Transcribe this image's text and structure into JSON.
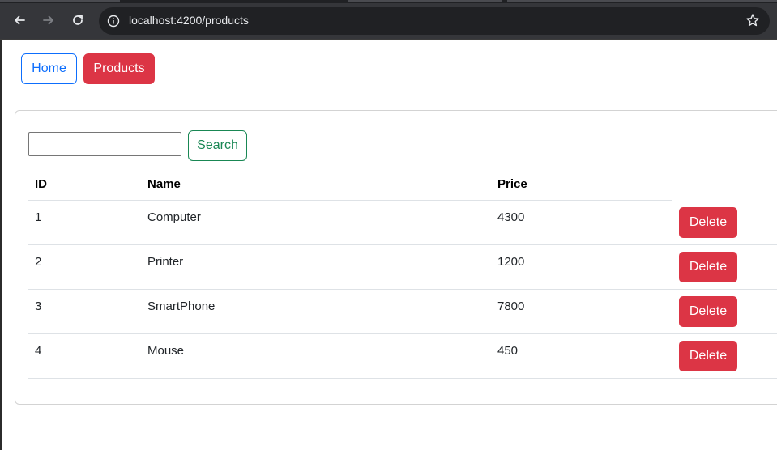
{
  "browser": {
    "url": "localhost:4200/products",
    "back_icon": "arrow-left-icon",
    "forward_icon": "arrow-right-icon",
    "reload_icon": "reload-icon",
    "site_info_icon": "info-icon",
    "bookmark_icon": "star-icon"
  },
  "nav": {
    "home_label": "Home",
    "products_label": "Products"
  },
  "search": {
    "value": "",
    "placeholder": "",
    "button_label": "Search"
  },
  "table": {
    "headers": [
      "ID",
      "Name",
      "Price"
    ],
    "rows": [
      {
        "id": "1",
        "name": "Computer",
        "price": "4300",
        "action": "Delete"
      },
      {
        "id": "2",
        "name": "Printer",
        "price": "1200",
        "action": "Delete"
      },
      {
        "id": "3",
        "name": "SmartPhone",
        "price": "7800",
        "action": "Delete"
      },
      {
        "id": "4",
        "name": "Mouse",
        "price": "450",
        "action": "Delete"
      }
    ]
  },
  "colors": {
    "primary": "#0d6efd",
    "danger": "#dc3545",
    "success": "#198754",
    "chrome_bg": "#35363a"
  }
}
